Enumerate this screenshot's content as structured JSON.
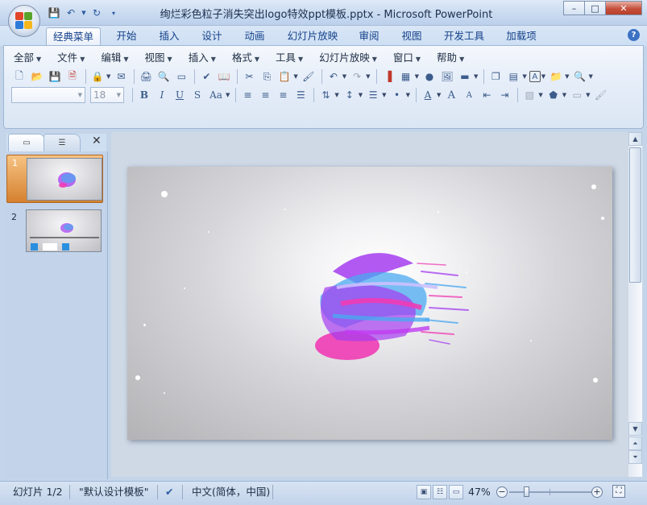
{
  "window": {
    "title": "绚烂彩色粒子消失突出logo特效ppt模板.pptx - Microsoft PowerPoint",
    "minimize": "–",
    "maximize": "□",
    "close": "✕"
  },
  "qat": {
    "icons": [
      "save-icon",
      "undo-icon",
      "dropdown-arrow",
      "redo-icon",
      "customize-icon"
    ]
  },
  "tabs": [
    {
      "label": "经典菜单"
    },
    {
      "label": "开始"
    },
    {
      "label": "插入"
    },
    {
      "label": "设计"
    },
    {
      "label": "动画"
    },
    {
      "label": "幻灯片放映"
    },
    {
      "label": "审阅"
    },
    {
      "label": "视图"
    },
    {
      "label": "开发工具"
    },
    {
      "label": "加载项"
    }
  ],
  "help": {
    "label": "?"
  },
  "menu": [
    {
      "label": "全部"
    },
    {
      "label": "文件"
    },
    {
      "label": "编辑"
    },
    {
      "label": "视图"
    },
    {
      "label": "插入"
    },
    {
      "label": "格式"
    },
    {
      "label": "工具"
    },
    {
      "label": "幻灯片放映"
    },
    {
      "label": "窗口"
    },
    {
      "label": "帮助"
    }
  ],
  "toolbar": {
    "font_name": "",
    "font_size": "18",
    "bold": "B",
    "italic": "I",
    "underline": "U",
    "strike": "S",
    "case": "Aa",
    "font_color": "A",
    "grow": "A",
    "shrink": "A"
  },
  "panel": {
    "close": "✕",
    "slides": [
      {
        "number": "1",
        "selected": true
      },
      {
        "number": "2",
        "selected": false
      }
    ]
  },
  "status": {
    "slide_info": "幻灯片 1/2",
    "theme": "\"默认设计模板\"",
    "language": "中文(简体，中国)",
    "zoom": "47%",
    "zoom_value": 47
  },
  "colors": {
    "accent": "#15428b",
    "selected_thumb": "#e7a456",
    "particle_purple": "#a53cf0",
    "particle_blue": "#4aa8f0",
    "particle_pink": "#f03cb4"
  }
}
